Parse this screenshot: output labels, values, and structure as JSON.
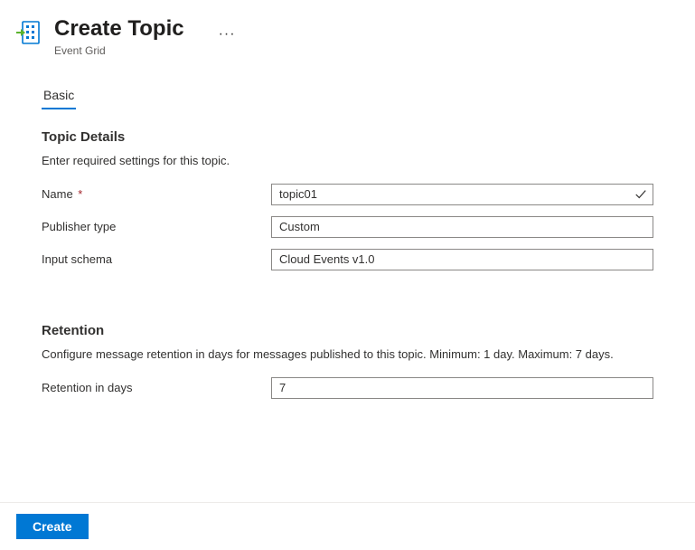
{
  "header": {
    "title": "Create Topic",
    "subtitle": "Event Grid"
  },
  "tabs": {
    "basic": "Basic"
  },
  "topic_details": {
    "heading": "Topic Details",
    "description": "Enter required settings for this topic.",
    "name_label": "Name",
    "name_value": "topic01",
    "publisher_type_label": "Publisher type",
    "publisher_type_value": "Custom",
    "input_schema_label": "Input schema",
    "input_schema_value": "Cloud Events v1.0"
  },
  "retention": {
    "heading": "Retention",
    "description": "Configure message retention in days for messages published to this topic. Minimum: 1 day. Maximum: 7 days.",
    "days_label": "Retention in days",
    "days_value": "7"
  },
  "footer": {
    "create_label": "Create"
  }
}
